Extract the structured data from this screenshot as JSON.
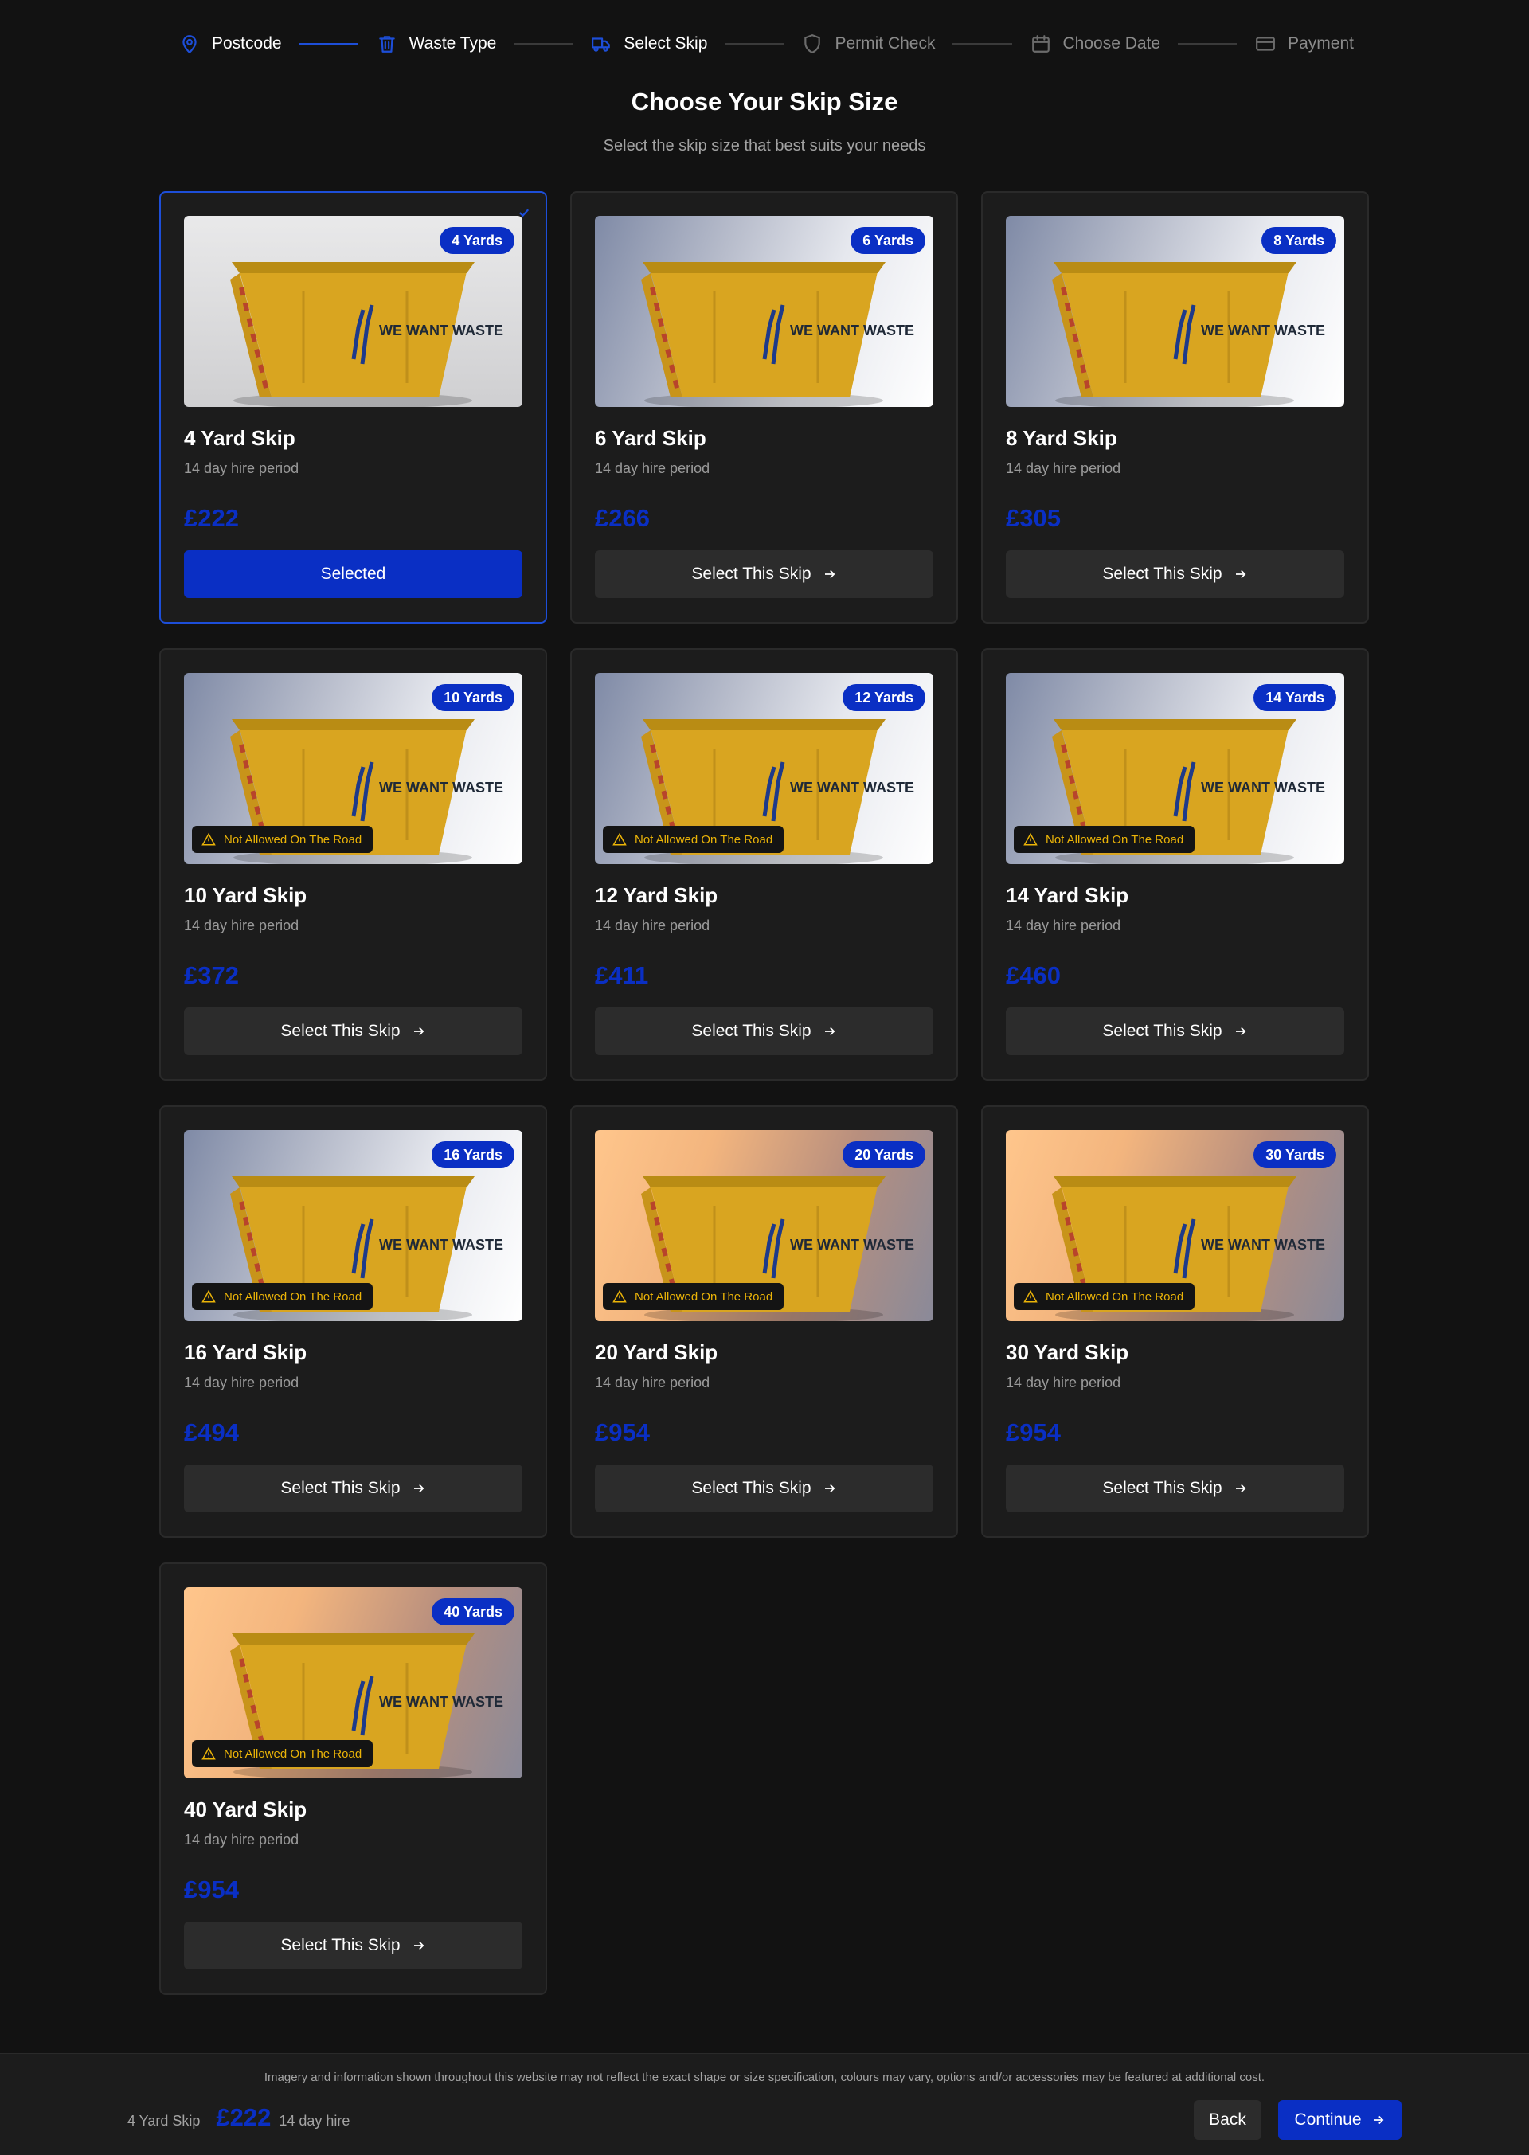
{
  "steps": [
    {
      "label": "Postcode",
      "icon": "map-pin-icon",
      "state": "done"
    },
    {
      "label": "Waste Type",
      "icon": "trash-icon",
      "state": "done"
    },
    {
      "label": "Select Skip",
      "icon": "truck-icon",
      "state": "active"
    },
    {
      "label": "Permit Check",
      "icon": "shield-icon",
      "state": "todo"
    },
    {
      "label": "Choose Date",
      "icon": "calendar-icon",
      "state": "todo"
    },
    {
      "label": "Payment",
      "icon": "credit-card-icon",
      "state": "todo"
    }
  ],
  "heading": {
    "title": "Choose Your Skip Size",
    "subtitle": "Select the skip size that best suits your needs"
  },
  "skips": [
    {
      "badge": "4 Yards",
      "title": "4 Yard Skip",
      "hire": "14 day hire period",
      "price": "£222",
      "button": "Selected",
      "selected": true,
      "road_warning": null,
      "image_style": "first"
    },
    {
      "badge": "6 Yards",
      "title": "6 Yard Skip",
      "hire": "14 day hire period",
      "price": "£266",
      "button": "Select This Skip",
      "selected": false,
      "road_warning": null,
      "image_style": "cool"
    },
    {
      "badge": "8 Yards",
      "title": "8 Yard Skip",
      "hire": "14 day hire period",
      "price": "£305",
      "button": "Select This Skip",
      "selected": false,
      "road_warning": null,
      "image_style": "cool"
    },
    {
      "badge": "10 Yards",
      "title": "10 Yard Skip",
      "hire": "14 day hire period",
      "price": "£372",
      "button": "Select This Skip",
      "selected": false,
      "road_warning": "Not Allowed On The Road",
      "image_style": "cool"
    },
    {
      "badge": "12 Yards",
      "title": "12 Yard Skip",
      "hire": "14 day hire period",
      "price": "£411",
      "button": "Select This Skip",
      "selected": false,
      "road_warning": "Not Allowed On The Road",
      "image_style": "cool"
    },
    {
      "badge": "14 Yards",
      "title": "14 Yard Skip",
      "hire": "14 day hire period",
      "price": "£460",
      "button": "Select This Skip",
      "selected": false,
      "road_warning": "Not Allowed On The Road",
      "image_style": "cool"
    },
    {
      "badge": "16 Yards",
      "title": "16 Yard Skip",
      "hire": "14 day hire period",
      "price": "£494",
      "button": "Select This Skip",
      "selected": false,
      "road_warning": "Not Allowed On The Road",
      "image_style": "cool"
    },
    {
      "badge": "20 Yards",
      "title": "20 Yard Skip",
      "hire": "14 day hire period",
      "price": "£954",
      "button": "Select This Skip",
      "selected": false,
      "road_warning": "Not Allowed On The Road",
      "image_style": "warm"
    },
    {
      "badge": "30 Yards",
      "title": "30 Yard Skip",
      "hire": "14 day hire period",
      "price": "£954",
      "button": "Select This Skip",
      "selected": false,
      "road_warning": "Not Allowed On The Road",
      "image_style": "warm"
    },
    {
      "badge": "40 Yards",
      "title": "40 Yard Skip",
      "hire": "14 day hire period",
      "price": "£954",
      "button": "Select This Skip",
      "selected": false,
      "road_warning": "Not Allowed On The Road",
      "image_style": "warm"
    }
  ],
  "skip_logo_text": "WE WANT WASTE",
  "footer": {
    "disclaimer": "Imagery and information shown throughout this website may not reflect the exact shape or size specification, colours may vary, options and/or accessories may be featured at additional cost.",
    "summary_name": "4 Yard Skip",
    "summary_price": "£222",
    "summary_hire": "14 day hire",
    "back_label": "Back",
    "continue_label": "Continue"
  },
  "colors": {
    "accent": "#0a2fc4",
    "background": "#121212",
    "card": "#1c1c1c",
    "warning": "#eab308"
  }
}
